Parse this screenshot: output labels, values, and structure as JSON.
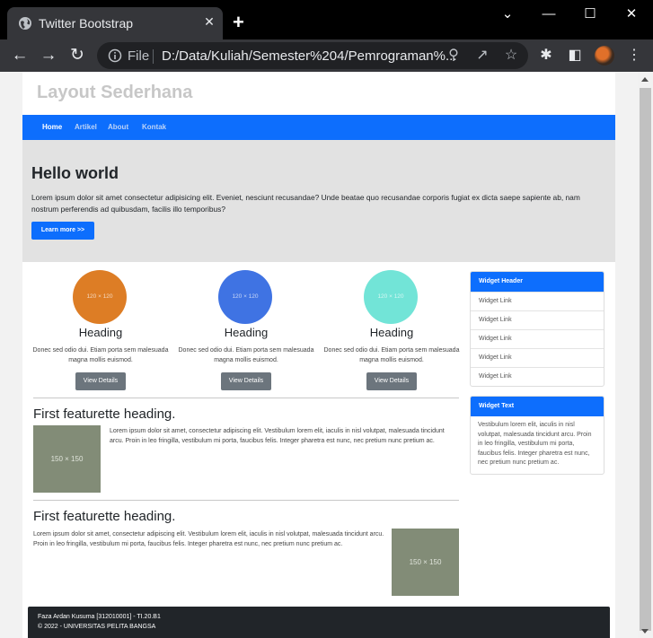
{
  "browser": {
    "tab_title": "Twitter Bootstrap",
    "tab_close": "✕",
    "new_tab": "+",
    "minimize": "—",
    "maximize": "☐",
    "close": "✕",
    "tab_search": "⌄",
    "file_label": "File",
    "url": "D:/Data/Kuliah/Semester%204/Pemrograman%..."
  },
  "site": {
    "title": "Layout Sederhana",
    "nav": [
      "Home",
      "Artikel",
      "About",
      "Kontak"
    ]
  },
  "hero": {
    "title": "Hello world",
    "text": "Lorem ipsum dolor sit amet consectetur adipisicing elit. Eveniet, nesciunt recusandae? Unde beatae quo recusandae corporis fugiat ex dicta saepe sapiente ab, nam nostrum perferendis ad quibusdam, facilis illo temporibus?",
    "button": "Learn more >>"
  },
  "features": [
    {
      "placeholder": "120 × 120",
      "heading": "Heading",
      "text": "Donec sed odio dui. Etiam porta sem malesuada magna mollis euismod.",
      "button": "View Details",
      "color": "#dd7d25"
    },
    {
      "placeholder": "120 × 120",
      "heading": "Heading",
      "text": "Donec sed odio dui. Etiam porta sem malesuada magna mollis euismod.",
      "button": "View Details",
      "color": "#3f73e3"
    },
    {
      "placeholder": "120 × 120",
      "heading": "Heading",
      "text": "Donec sed odio dui. Etiam porta sem malesuada magna mollis euismod.",
      "button": "View Details",
      "color": "#72e4d7"
    }
  ],
  "featurettes": [
    {
      "heading": "First featurette heading.",
      "placeholder": "150 × 150",
      "text": "Lorem ipsum dolor sit amet, consectetur adipiscing elit. Vestibulum lorem elit, iaculis in nisl volutpat, malesuada tincidunt arcu. Proin in leo fringilla, vestibulum mi porta, faucibus felis. Integer pharetra est nunc, nec pretium nunc pretium ac."
    },
    {
      "heading": "First featurette heading.",
      "placeholder": "150 × 150",
      "text": "Lorem ipsum dolor sit amet, consectetur adipiscing elit. Vestibulum lorem elit, iaculis in nisl volutpat, malesuada tincidunt arcu. Proin in leo fringilla, vestibulum mi porta, faucibus felis. Integer pharetra est nunc, nec pretium nunc pretium ac."
    }
  ],
  "widgets": {
    "links_header": "Widget Header",
    "links": [
      "Widget Link",
      "Widget Link",
      "Widget Link",
      "Widget Link",
      "Widget Link"
    ],
    "text_header": "Widget Text",
    "text": "Vestibulum lorem elit, iaculis in nisl volutpat, malesuada tincidunt arcu. Proin in leo fringilla, vestibulum mi porta, faucibus felis. Integer pharetra est nunc, nec pretium nunc pretium ac."
  },
  "footer": {
    "line1": "Faza Ardan Kusuma [312010001] - TI.20.B1",
    "line2": "© 2022 - UNIVERSITAS PELITA BANGSA"
  },
  "colors": {
    "primary": "#0d6efd",
    "secondary": "#6c757d",
    "footer_bg": "#212529",
    "jumbotron_bg": "#e2e2e2",
    "placeholder_bg": "#828c77"
  }
}
